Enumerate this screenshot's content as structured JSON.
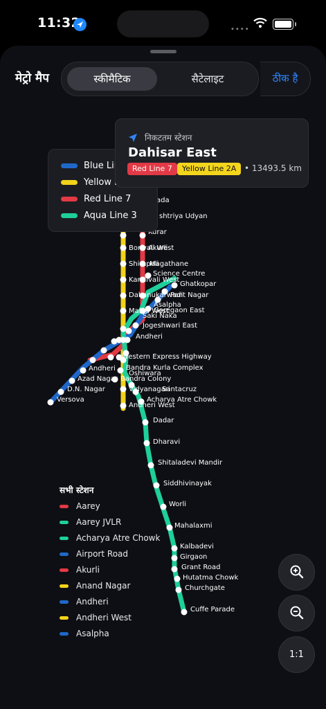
{
  "status_bar": {
    "time": "11:32",
    "dots": "••••"
  },
  "header": {
    "title": "मेट्रो मैप",
    "tab_schematic": "स्कीमैटिक",
    "tab_satellite": "सैटेलाइट",
    "done": "ठीक है"
  },
  "colors": {
    "blue": "#1f68c9",
    "yellow": "#f2d21b",
    "red": "#e23a44",
    "aqua": "#1fcf9b",
    "accent": "#2f86ff"
  },
  "legend": [
    {
      "name": "Blue Line",
      "color": "#1f68c9"
    },
    {
      "name": "Yellow Line 2A",
      "color": "#f2d21b"
    },
    {
      "name": "Red Line 7",
      "color": "#e23a44"
    },
    {
      "name": "Aqua Line 3",
      "color": "#1fcf9b"
    }
  ],
  "nearest": {
    "heading": "निकटतम स्टेशन",
    "name": "Dahisar East",
    "badge_red": "Red Line 7",
    "badge_yellow": "Yellow Line 2A",
    "distance": "• 13493.5 km"
  },
  "station_labels": [
    "ada",
    "shtriya Udyan",
    "Kurar",
    "Borivali West",
    "Akurli",
    "Shimpoli",
    "Magathane",
    "Kandivali West",
    "Science Centre",
    "Ghatkopar",
    "Dahanukarwadi",
    "Pant Nagar",
    "Malad West",
    "Goregaon East",
    "Asalpha",
    "Saki Naka",
    "Jogeshwari East",
    "Andheri",
    "Western Express Highway",
    "Bandra Kurla Complex",
    "Andheri",
    "Azad Nagar",
    "D.N. Nagar",
    "Versova",
    "Oshiwara",
    "Bandra Colony",
    "Vidyanagari",
    "Santacruz",
    "Andheri West",
    "Acharya Atre Chowk",
    "Dadar",
    "Dharavi",
    "Shitaladevi Mandir",
    "Siddhivinayak",
    "Worli",
    "Mahalaxmi",
    "Kalbadevi",
    "Girgaon",
    "Grant Road",
    "Hutatma Chowk",
    "Churchgate",
    "Cuffe Parade"
  ],
  "all_stations": {
    "title": "सभी स्टेशन",
    "items": [
      {
        "name": "Aarey",
        "color": "#e23a44"
      },
      {
        "name": "Aarey JVLR",
        "color": "#1fcf9b"
      },
      {
        "name": "Acharya Atre Chowk",
        "color": "#1fcf9b"
      },
      {
        "name": "Airport Road",
        "color": "#1f68c9"
      },
      {
        "name": "Akurli",
        "color": "#e23a44"
      },
      {
        "name": "Anand Nagar",
        "color": "#f2d21b"
      },
      {
        "name": "Andheri",
        "color": "#1f68c9"
      },
      {
        "name": "Andheri West",
        "color": "#f2d21b"
      },
      {
        "name": "Asalpha",
        "color": "#1f68c9"
      }
    ]
  },
  "zoom": {
    "in_icon": "zoom-in-icon",
    "out_icon": "zoom-out-icon",
    "reset_label": "1:1"
  }
}
